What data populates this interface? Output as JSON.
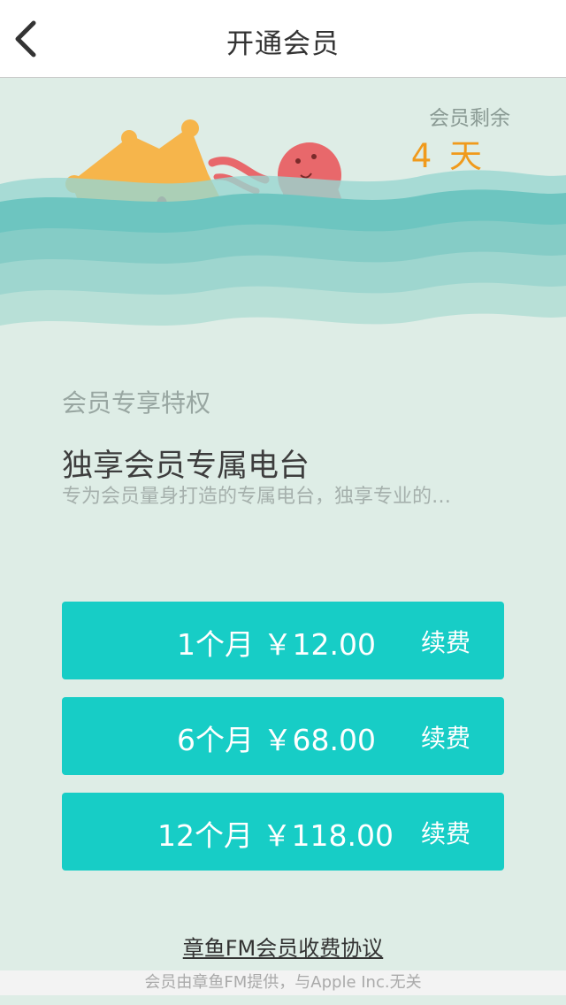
{
  "nav": {
    "title": "开通会员",
    "back_icon": "chevron-left-icon"
  },
  "membership": {
    "remaining_label": "会员剩余",
    "remaining_value": "4 天"
  },
  "privilege": {
    "section_title": "会员专享特权",
    "feature_title": "独享会员专属电台",
    "feature_desc": "专为会员量身打造的专属电台，独享专业的…"
  },
  "plans": [
    {
      "price": "1个月 ￥12.00",
      "action": "续费"
    },
    {
      "price": "6个月 ￥68.00",
      "action": "续费"
    },
    {
      "price": "12个月 ￥118.00",
      "action": "续费"
    }
  ],
  "agreement_link": "章鱼FM会员收费协议",
  "footer_note": "会员由章鱼FM提供，与Apple Inc.无关",
  "colors": {
    "accent": "#17cdc6",
    "highlight": "#f09a1c",
    "background": "#deede6",
    "octopus": "#e8686b",
    "crown": "#f6b54b",
    "wave": "#6dc5c0"
  }
}
